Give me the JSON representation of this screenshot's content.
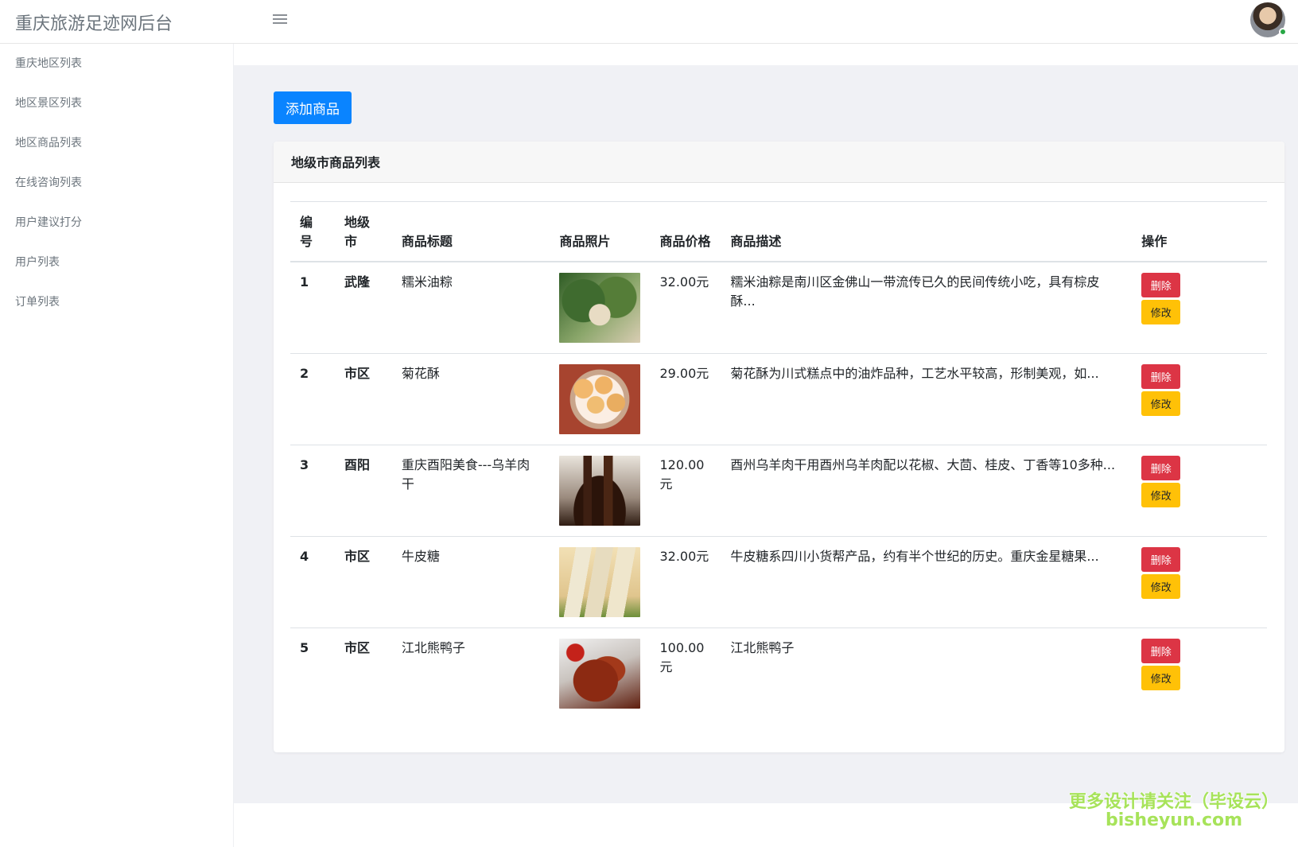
{
  "app": {
    "title": "重庆旅游足迹网后台"
  },
  "sidebar": {
    "items": [
      {
        "label": "重庆地区列表"
      },
      {
        "label": "地区景区列表"
      },
      {
        "label": "地区商品列表"
      },
      {
        "label": "在线咨询列表"
      },
      {
        "label": "用户建议打分"
      },
      {
        "label": "用户列表"
      },
      {
        "label": "订单列表"
      }
    ]
  },
  "toolbar": {
    "add_label": "添加商品"
  },
  "card": {
    "title": "地级市商品列表"
  },
  "table": {
    "headers": [
      "编号",
      "地级市",
      "商品标题",
      "商品照片",
      "商品价格",
      "商品描述",
      "操作"
    ],
    "rows": [
      {
        "id": "1",
        "region": "武隆",
        "title": "糯米油粽",
        "photo": "zongzi-photo",
        "price": "32.00元",
        "desc": "糯米油粽是南川区金佛山一带流传已久的民间传统小吃，具有棕皮酥..."
      },
      {
        "id": "2",
        "region": "市区",
        "title": "菊花酥",
        "photo": "juhua-photo",
        "price": "29.00元",
        "desc": "菊花酥为川式糕点中的油炸品种，工艺水平较高，形制美观，如..."
      },
      {
        "id": "3",
        "region": "酉阳",
        "title": "重庆酉阳美食---乌羊肉干",
        "photo": "yangrou-photo",
        "price": "120.00元",
        "desc": "酉州乌羊肉干用酉州乌羊肉配以花椒、大茴、桂皮、丁香等10多种..."
      },
      {
        "id": "4",
        "region": "市区",
        "title": "牛皮糖",
        "photo": "niupi-photo",
        "price": "32.00元",
        "desc": "牛皮糖系四川小货帮产品，约有半个世纪的历史。重庆金星糖果..."
      },
      {
        "id": "5",
        "region": "市区",
        "title": "江北熊鸭子",
        "photo": "duck-photo",
        "price": "100.00元",
        "desc": "江北熊鸭子"
      }
    ],
    "actions": {
      "delete_label": "删除",
      "edit_label": "修改"
    }
  },
  "watermark": {
    "line1": "更多设计请关注（毕设云）",
    "line2": "bisheyun.com"
  },
  "colors": {
    "primary": "#0a84ff",
    "danger": "#dc3545",
    "warning": "#ffc107",
    "background": "#f0f1f5"
  }
}
